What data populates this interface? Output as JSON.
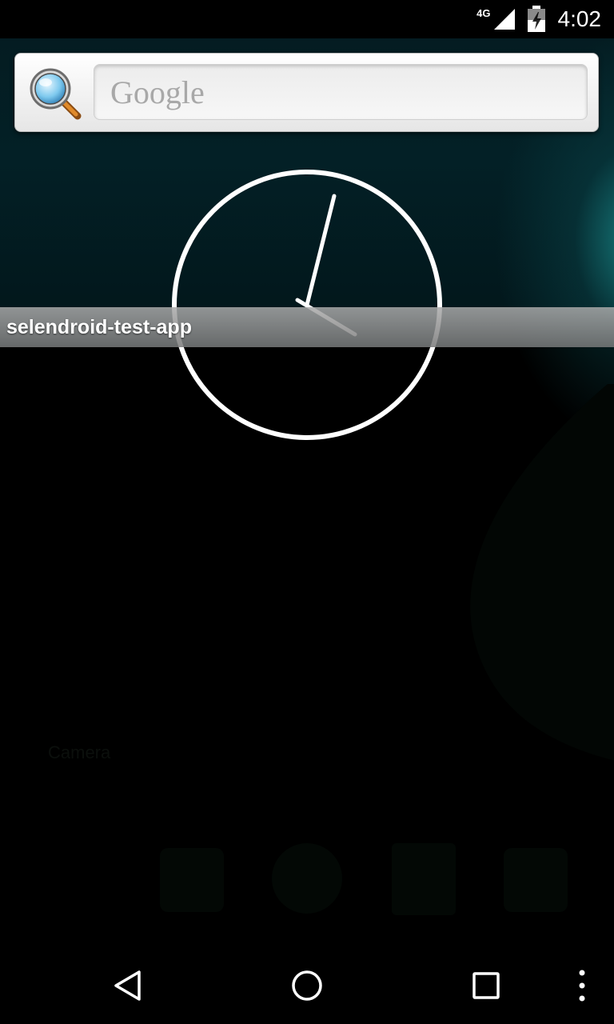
{
  "status_bar": {
    "network_type": "4G",
    "time": "4:02"
  },
  "search_widget": {
    "placeholder": "Google",
    "icon": "magnifier-icon"
  },
  "clock_widget": {
    "type": "analog",
    "icon": "analog-clock-icon"
  },
  "app_label": {
    "text": "selendroid-test-app"
  },
  "background": {
    "faint_text_1": "",
    "faint_text_2": "Camera"
  },
  "nav_bar": {
    "back_icon": "back-triangle-icon",
    "home_icon": "home-circle-icon",
    "recents_icon": "recents-square-icon",
    "menu_icon": "overflow-menu-icon"
  },
  "colors": {
    "status_bar": "#000000",
    "accent_teal": "#1ea0a0",
    "label_bar": "#9a9a9a"
  }
}
